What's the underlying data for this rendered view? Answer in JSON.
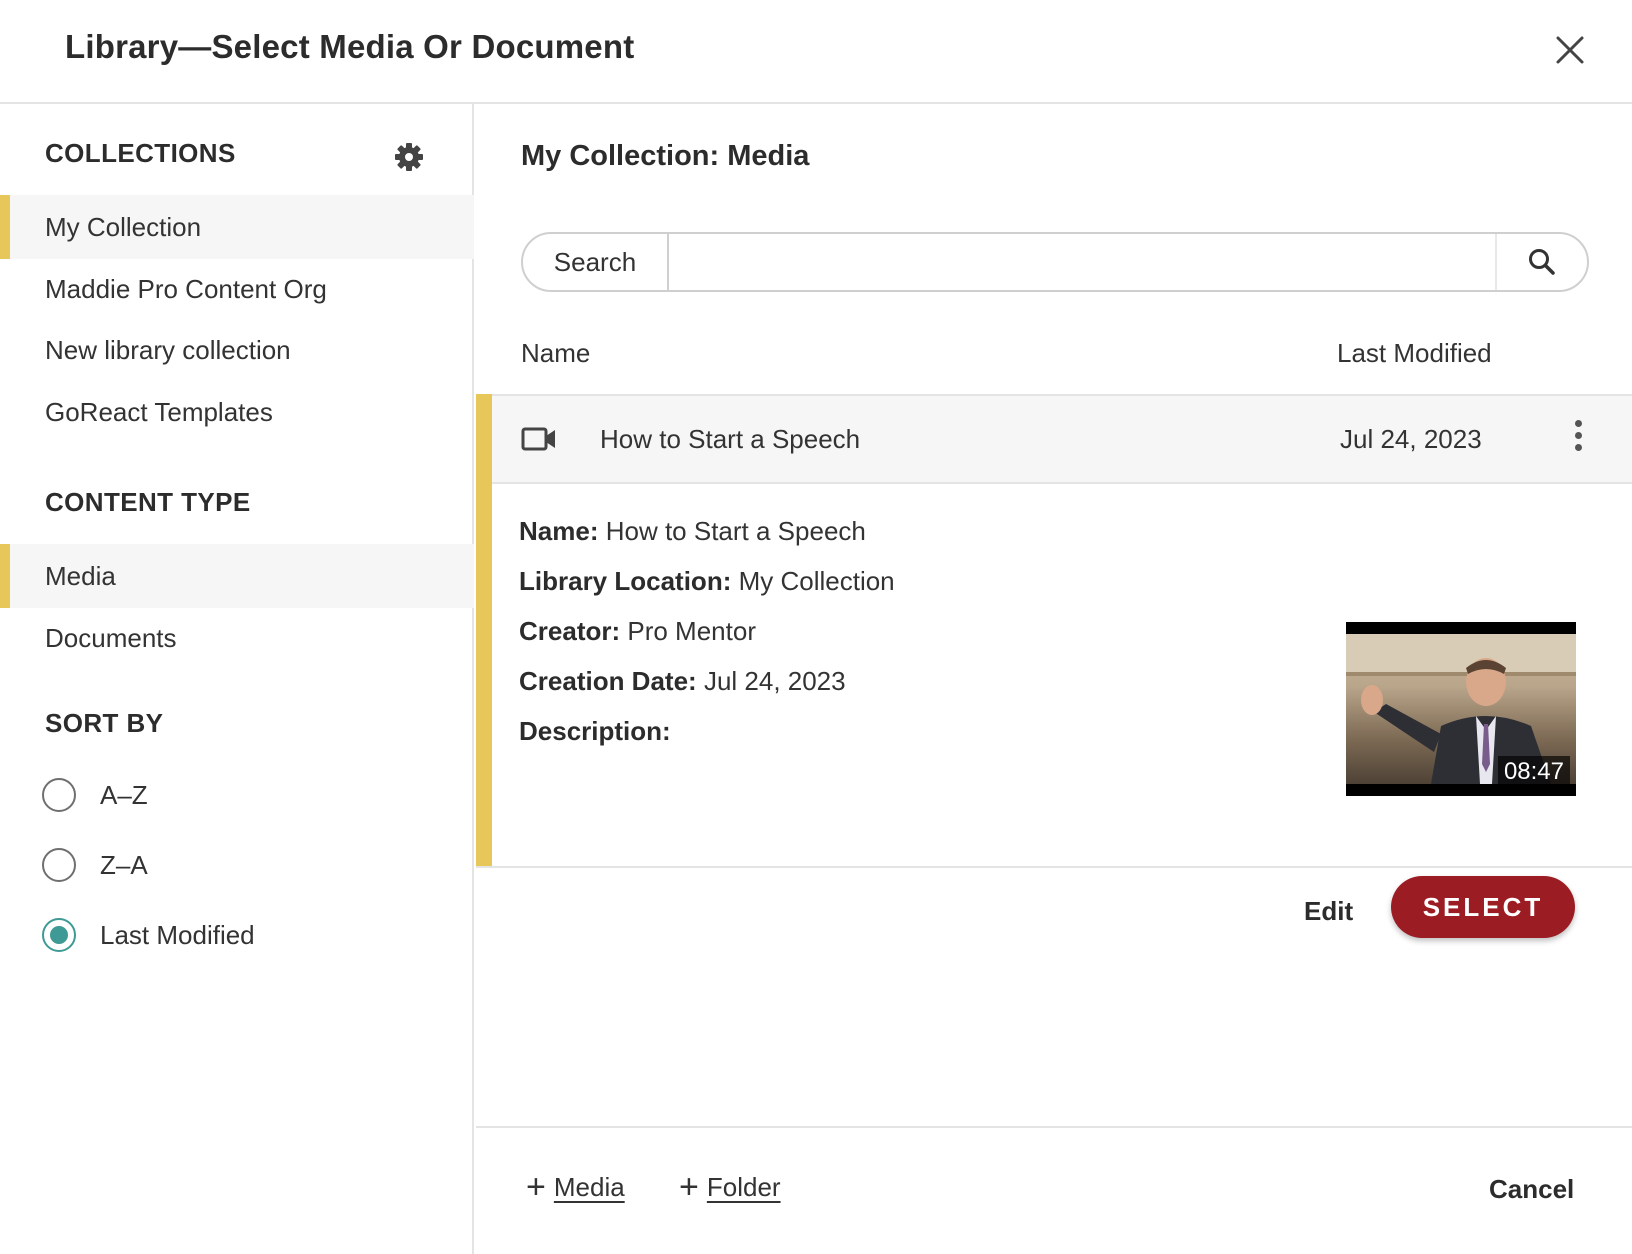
{
  "dialog": {
    "title": "Library—Select Media Or Document"
  },
  "sidebar": {
    "collections_heading": "COLLECTIONS",
    "collections": [
      {
        "label": "My Collection",
        "active": true
      },
      {
        "label": "Maddie Pro Content Org",
        "active": false
      },
      {
        "label": "New library collection",
        "active": false
      },
      {
        "label": "GoReact Templates",
        "active": false
      }
    ],
    "content_type_heading": "CONTENT TYPE",
    "content_types": [
      {
        "label": "Media",
        "active": true
      },
      {
        "label": "Documents",
        "active": false
      }
    ],
    "sort_heading": "SORT BY",
    "sort_options": [
      {
        "label": "A–Z",
        "checked": false
      },
      {
        "label": "Z–A",
        "checked": false
      },
      {
        "label": "Last Modified",
        "checked": true
      }
    ]
  },
  "main": {
    "title": "My Collection: Media",
    "search": {
      "label": "Search",
      "value": "",
      "placeholder": ""
    },
    "columns": {
      "name": "Name",
      "modified": "Last Modified"
    },
    "items": [
      {
        "icon": "video-camera-icon",
        "name": "How to Start a Speech",
        "modified": "Jul 24, 2023",
        "expanded": true,
        "details": {
          "name_label": "Name:",
          "name_value": "How to Start a Speech",
          "location_label": "Library Location:",
          "location_value": "My Collection",
          "creator_label": "Creator:",
          "creator_value": "Pro Mentor",
          "date_label": "Creation Date:",
          "date_value": "Jul 24, 2023",
          "description_label": "Description:",
          "description_value": "",
          "duration": "08:47"
        },
        "edit_label": "Edit",
        "select_label": "SELECT"
      }
    ]
  },
  "footer": {
    "add_media": "Media",
    "add_folder": "Folder",
    "cancel": "Cancel"
  },
  "colors": {
    "accent": "#e8c75a",
    "primary_button": "#9c1c24",
    "radio_checked": "#3f9a95"
  }
}
